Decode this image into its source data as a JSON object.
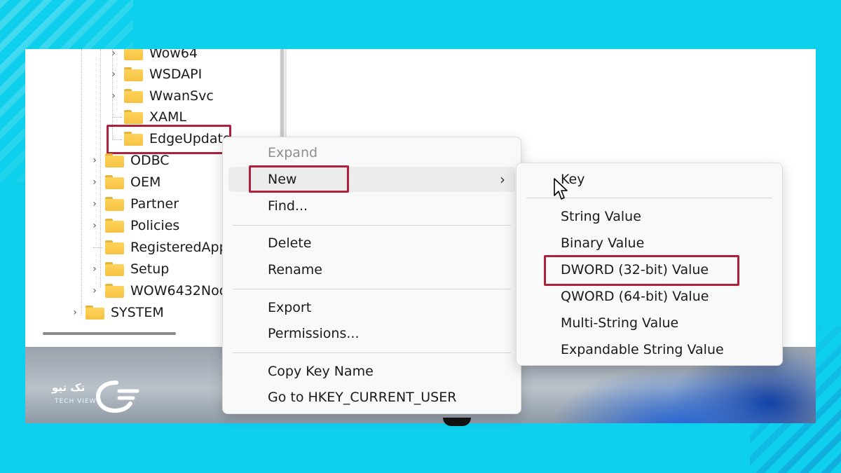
{
  "tree": {
    "items": [
      {
        "label": "Wow64",
        "chevron": true
      },
      {
        "label": "WSDAPI",
        "chevron": true
      },
      {
        "label": "WwanSvc",
        "chevron": true
      },
      {
        "label": "XAML",
        "chevron": false
      },
      {
        "label": "EdgeUpdate",
        "chevron": false,
        "highlighted": true
      },
      {
        "label": "ODBC",
        "chevron": true
      },
      {
        "label": "OEM",
        "chevron": true
      },
      {
        "label": "Partner",
        "chevron": true
      },
      {
        "label": "Policies",
        "chevron": true
      },
      {
        "label": "RegisteredApp",
        "chevron": false
      },
      {
        "label": "Setup",
        "chevron": true
      },
      {
        "label": "WOW6432Nod",
        "chevron": true
      },
      {
        "label": "SYSTEM",
        "chevron": true
      }
    ]
  },
  "context_menu": {
    "items": [
      {
        "label": "Expand",
        "disabled": true
      },
      {
        "label": "New",
        "has_submenu": true,
        "highlighted": true
      },
      {
        "label": "Find..."
      },
      {
        "label": "Delete"
      },
      {
        "label": "Rename"
      },
      {
        "label": "Export"
      },
      {
        "label": "Permissions..."
      },
      {
        "label": "Copy Key Name"
      },
      {
        "label": "Go to HKEY_CURRENT_USER"
      }
    ],
    "submenu_arrow": "›"
  },
  "submenu": {
    "items": [
      {
        "label": "Key"
      },
      {
        "label": "String Value"
      },
      {
        "label": "Binary Value"
      },
      {
        "label": "DWORD (32-bit) Value",
        "highlighted": true
      },
      {
        "label": "QWORD (64-bit) Value"
      },
      {
        "label": "Multi-String Value"
      },
      {
        "label": "Expandable String Value"
      }
    ]
  },
  "logo": {
    "arabic": "تک تیو",
    "english": "TECH VIEW"
  },
  "icons": {
    "chevron": "›",
    "folder": "folder-icon"
  },
  "colors": {
    "background": "#0fd0ec",
    "highlight_border": "#b1203a",
    "folder": "#f6c143"
  }
}
